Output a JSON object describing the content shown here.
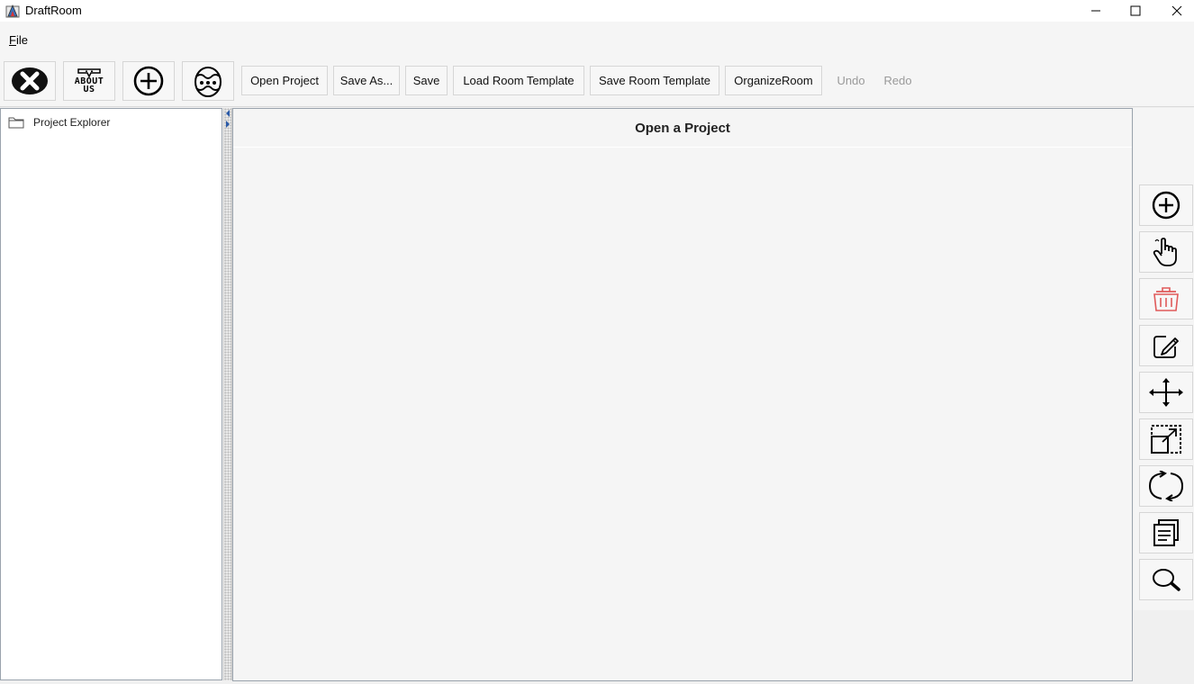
{
  "window": {
    "title": "DraftRoom",
    "controls": [
      "minimize-icon",
      "maximize-icon",
      "close-icon"
    ]
  },
  "menubar": {
    "file_mnemonic": "F",
    "file_rest": "ile"
  },
  "toolbar": {
    "icon_buttons": [
      {
        "name": "exit-icon"
      },
      {
        "name": "about-us-icon",
        "line1": "ABOUT",
        "line2": "US"
      },
      {
        "name": "add-icon"
      },
      {
        "name": "easter-egg-icon"
      }
    ],
    "open_project": "Open Project",
    "save_as": "Save As...",
    "save": "Save",
    "load_room_template": "Load Room Template",
    "save_room_template": "Save Room Template",
    "organize_room": "OrganizeRoom",
    "undo": "Undo",
    "redo": "Redo"
  },
  "explorer": {
    "root_label": "Project Explorer"
  },
  "main": {
    "header": "Open a Project"
  },
  "tools": [
    {
      "name": "add-icon"
    },
    {
      "name": "hand-pointer-icon"
    },
    {
      "name": "trash-icon",
      "color": "#e05a5a"
    },
    {
      "name": "edit-icon"
    },
    {
      "name": "move-icon"
    },
    {
      "name": "resize-icon"
    },
    {
      "name": "rotate-icon"
    },
    {
      "name": "copy-icon"
    },
    {
      "name": "search-icon"
    }
  ]
}
